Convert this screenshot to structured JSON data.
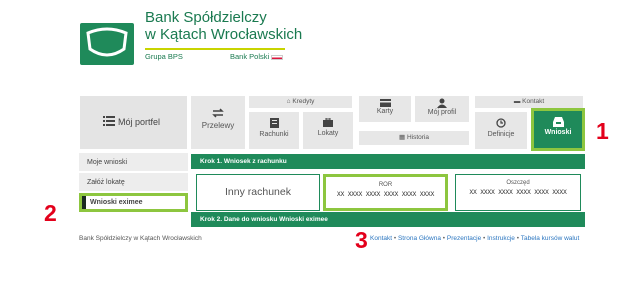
{
  "brand": {
    "name_line1": "Bank Spółdzielczy",
    "name_line2": "w Kątach Wrocławskich",
    "group": "Grupa BPS",
    "bank_polski": "Bank Polski",
    "accent": "#1f8a5a",
    "highlight": "#8dc63f"
  },
  "nav": {
    "portfel": "Mój portfel",
    "przelewy": "Przelewy",
    "kredyty": "Kredyty",
    "rachunki": "Rachunki",
    "lokaty": "Lokaty",
    "karty": "Karty",
    "profil": "Mój profil",
    "historia": "Historia",
    "kontakt": "Kontakt",
    "definicje": "Definicje",
    "wnioski": "Wnioski"
  },
  "sidebar": {
    "items": [
      {
        "label": "Moje wnioski"
      },
      {
        "label": "Załóż lokatę"
      },
      {
        "label": "Wnioski eximee"
      }
    ]
  },
  "steps": {
    "step1": "Krok 1. Wniosek z rachunku",
    "step2": "Krok 2. Dane do wniosku Wnioski eximee"
  },
  "accounts": {
    "inny": "Inny rachunek",
    "ror_title": "ROR",
    "ror_number": "XX XXXX XXXX XXXX XXXX XXXX",
    "osz_title": "Oszczęd",
    "osz_number": "XX XXXX XXXX XXXX XXXX XXXX"
  },
  "footer": {
    "left": "Bank Spółdzielczy w Kątach Wrocławskich",
    "links": [
      "Kontakt",
      "Strona Główna",
      "Prezentacje",
      "Instrukcje",
      "Tabela kursów walut"
    ],
    "separator": "•"
  },
  "markers": {
    "m1": "1",
    "m2": "2",
    "m3": "3"
  }
}
